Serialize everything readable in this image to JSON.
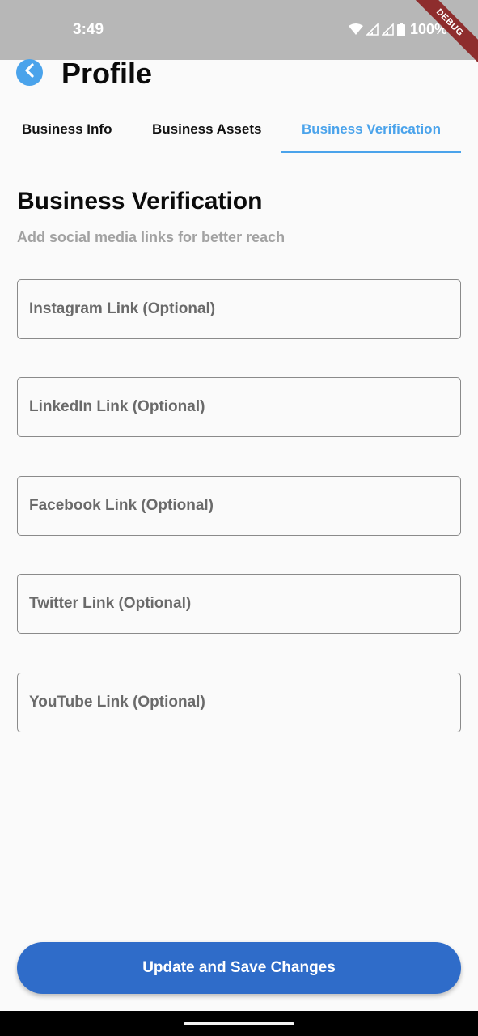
{
  "status_bar": {
    "time": "3:49",
    "battery": "100%",
    "debug_label": "DEBUG"
  },
  "header": {
    "title": "Profile",
    "back_icon": "chevron-left-icon"
  },
  "tabs": [
    {
      "label": "Business Info",
      "active": false
    },
    {
      "label": "Business Assets",
      "active": false
    },
    {
      "label": "Business Verification",
      "active": true
    }
  ],
  "section": {
    "title": "Business Verification",
    "subtitle": "Add social media links for better reach"
  },
  "fields": [
    {
      "placeholder": "Instagram Link (Optional)",
      "value": ""
    },
    {
      "placeholder": "LinkedIn Link (Optional)",
      "value": ""
    },
    {
      "placeholder": "Facebook Link (Optional)",
      "value": ""
    },
    {
      "placeholder": "Twitter Link (Optional)",
      "value": ""
    },
    {
      "placeholder": "YouTube Link (Optional)",
      "value": ""
    }
  ],
  "actions": {
    "save_label": "Update and Save Changes"
  },
  "colors": {
    "accent": "#4aa3eb",
    "primary_button": "#2f6cc9",
    "status_bar": "#b7b7b7",
    "debug_ribbon": "#8e2d2d"
  }
}
